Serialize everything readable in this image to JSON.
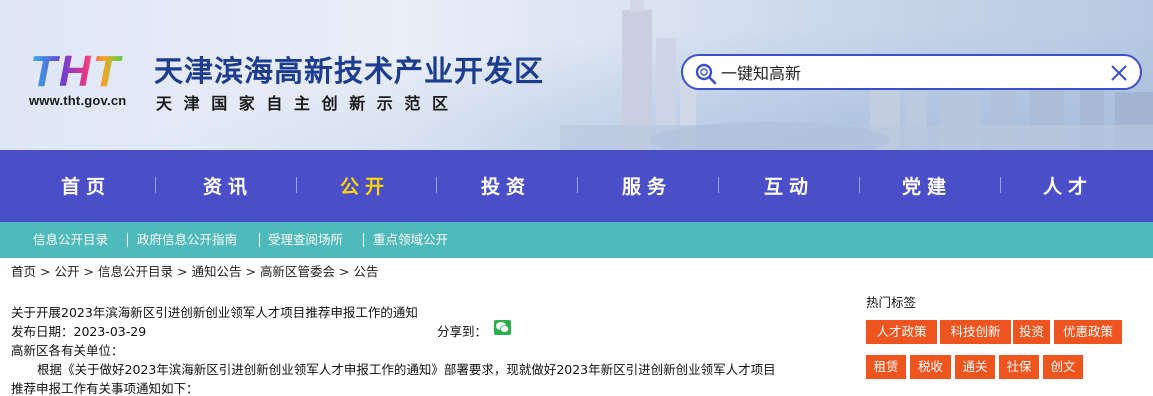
{
  "header": {
    "logo_text": "THT",
    "url": "www.tht.gov.cn",
    "title": "天津滨海高新技术产业开发区",
    "subtitle": "天津国家自主创新示范区"
  },
  "search": {
    "placeholder": "一键知高新"
  },
  "mainnav": [
    "首页",
    "资讯",
    "公开",
    "投资",
    "服务",
    "互动",
    "党建",
    "人才"
  ],
  "mainnav_active": "公开",
  "subnav": [
    "信息公开目录",
    "政府信息公开指南",
    "受理查阅场所",
    "重点领域公开"
  ],
  "breadcrumb": [
    "首页",
    "公开",
    "信息公开目录",
    "通知公告",
    "高新区管委会",
    "公告"
  ],
  "article": {
    "title": "关于开展2023年滨海新区引进创新创业领军人才项目推荐申报工作的通知",
    "date_label": "发布日期：2023-03-29",
    "share_label": "分享到：",
    "salutation": "高新区各有关单位：",
    "body_line1": "根据《关于做好2023年滨海新区引进创新创业领军人才申报工作的通知》部署要求，现就做好2023年新区引进创新创业领军人才项目",
    "body_line2": "推荐申报工作有关事项通知如下："
  },
  "hot_tags": {
    "title": "热门标签",
    "row1": [
      "人才政策",
      "科技创新",
      "投资",
      "优惠政策"
    ],
    "row2": [
      "租赁",
      "税收",
      "通关",
      "社保",
      "创文"
    ]
  },
  "colors": {
    "nav_bg": "#4a4ec9",
    "nav_active": "#ffd400",
    "subnav_bg": "#4fbabc",
    "tag_bg": "#f0541e",
    "title_blue": "#1c3d8f",
    "search_border": "#3b4fcf"
  }
}
